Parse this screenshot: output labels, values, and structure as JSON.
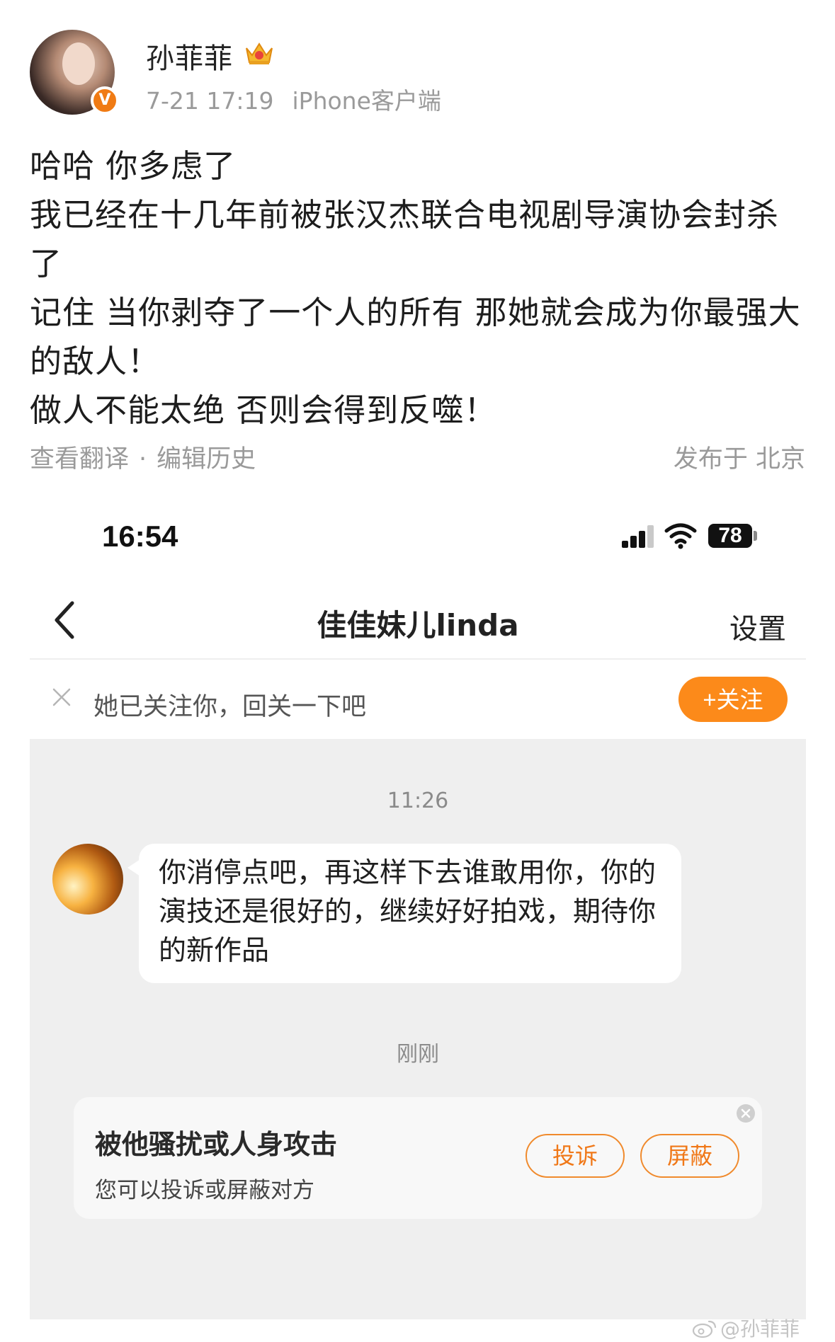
{
  "post": {
    "username": "孙菲菲",
    "verified_mark": "V",
    "date": "7-21 17:19",
    "client": "iPhone客户端",
    "lines": [
      "哈哈 你多虑了",
      "我已经在十几年前被张汉杰联合电视剧导演协会封杀了",
      "记住 当你剥夺了一个人的所有 那她就会成为你最强大的敌人！",
      "做人不能太绝 否则会得到反噬！"
    ],
    "translate_link": "查看翻译",
    "separator": "·",
    "edit_history_link": "编辑历史",
    "location": "发布于 北京"
  },
  "screenshot": {
    "status_time": "16:54",
    "battery": "78",
    "nav": {
      "title": "佳佳妹儿linda",
      "settings": "设置"
    },
    "follow_bar": {
      "text": "她已关注你，回关一下吧",
      "button": "+关注"
    },
    "timestamp_1": "11:26",
    "message": "你消停点吧，再这样下去谁敢用你，你的演技还是很好的，继续好好拍戏，期待你的新作品",
    "timestamp_2": "刚刚",
    "report_card": {
      "title": "被他骚扰或人身攻击",
      "subtitle": "您可以投诉或屏蔽对方",
      "report_button": "投诉",
      "block_button": "屏蔽"
    }
  },
  "watermark": "@孙菲菲",
  "colors": {
    "accent_orange": "#fc8a1a",
    "verified_orange": "#f07b14",
    "meta_gray": "#9a9a9a",
    "chat_background": "#efefef"
  }
}
